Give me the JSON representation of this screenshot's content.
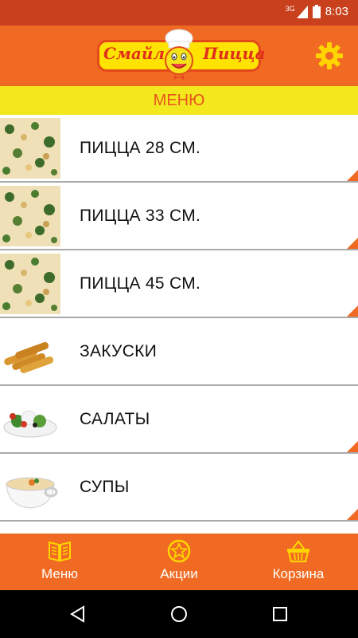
{
  "status_bar": {
    "network": "3G",
    "time": "8:03"
  },
  "header": {
    "logo_text_left": "Смайл",
    "logo_text_right": "Пицца",
    "icons": {
      "settings": "gear-icon"
    }
  },
  "menu_title": "МЕНЮ",
  "menu_items": [
    {
      "label": "ПИЦЦА 28 СМ.",
      "image": "pizza-image"
    },
    {
      "label": "ПИЦЦА 33 СМ.",
      "image": "pizza-image"
    },
    {
      "label": "ПИЦЦА 45 СМ.",
      "image": "pizza-image"
    },
    {
      "label": "ЗАКУСКИ",
      "image": "snacks-image"
    },
    {
      "label": "САЛАТЫ",
      "image": "salad-image"
    },
    {
      "label": "СУПЫ",
      "image": "soup-image"
    }
  ],
  "tabs": [
    {
      "label": "Меню",
      "icon": "book-icon"
    },
    {
      "label": "Акции",
      "icon": "star-badge-icon"
    },
    {
      "label": "Корзина",
      "icon": "basket-icon"
    }
  ],
  "colors": {
    "primary": "#f06a23",
    "statusbar": "#c8401c",
    "menu_header_bg": "#f3e81d",
    "menu_header_text": "#e8551d"
  }
}
